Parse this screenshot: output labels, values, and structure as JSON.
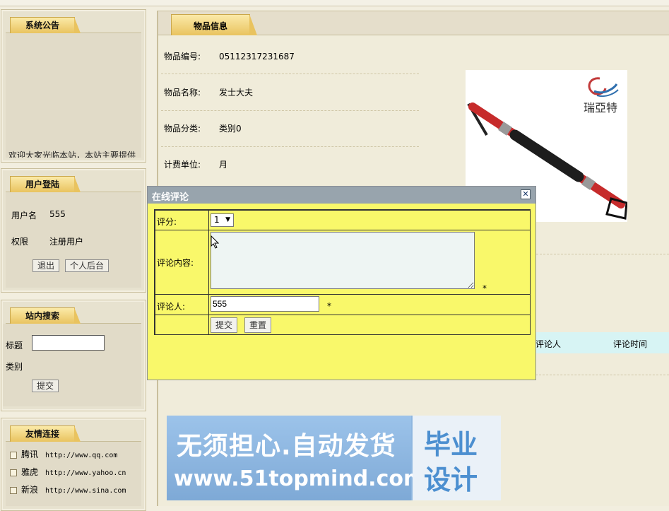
{
  "sidebar": {
    "notice": {
      "title": "系统公告",
      "text": "欢迎大家光临本站，本站主要提供"
    },
    "login": {
      "title": "用户登陆",
      "username_label": "用户名",
      "username_value": "555",
      "role_label": "权限",
      "role_value": "注册用户",
      "logout_label": "退出",
      "backend_label": "个人后台"
    },
    "search": {
      "title": "站内搜索",
      "title_label": "标题",
      "category_label": "类别",
      "submit_label": "提交"
    },
    "links": {
      "title": "友情连接",
      "items": [
        {
          "name": "腾讯",
          "url": "http://www.qq.com"
        },
        {
          "name": "雅虎",
          "url": "http://www.yahoo.cn"
        },
        {
          "name": "新浪",
          "url": "http://www.sina.com"
        }
      ]
    }
  },
  "main": {
    "tab_title": "物品信息",
    "fields": [
      {
        "label": "物品编号:",
        "value": "05112317231687"
      },
      {
        "label": "物品名称:",
        "value": "发士大夫"
      },
      {
        "label": "物品分类:",
        "value": "类别0"
      },
      {
        "label": "计费单位:",
        "value": "月"
      }
    ],
    "image_brand": "瑞亞特",
    "comment_columns": {
      "author": "评论人",
      "time": "评论时间"
    },
    "banner": {
      "line1": "无须担心.自动发货",
      "line2": "www.51topmind.com",
      "right1": "毕业",
      "right2": "设计"
    }
  },
  "dialog": {
    "title": "在线评论",
    "close_glyph": "✕",
    "score_label": "评分:",
    "score_value": "1",
    "content_label": "评论内容:",
    "author_label": "评论人:",
    "author_value": "555",
    "required_mark": "*",
    "submit_label": "提交",
    "reset_label": "重置"
  }
}
